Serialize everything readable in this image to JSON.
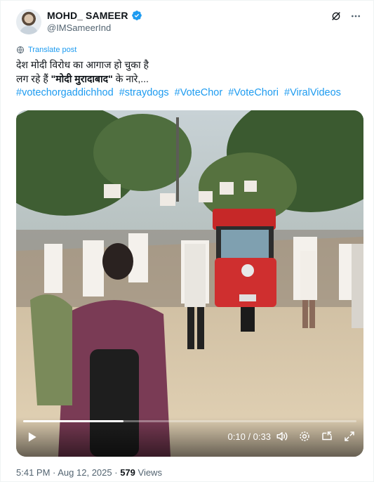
{
  "author": {
    "display_name": "MOHD_ SAMEER",
    "handle": "@IMSameerInd",
    "verified_icon": "verified-badge-icon"
  },
  "header_actions": [
    "grok-icon",
    "more-icon"
  ],
  "translate_label": "Translate post",
  "tweet": {
    "line1": "देश मोदी विरोध का आगाज हो चुका है",
    "line2_prefix": "लग रहे हैं ",
    "line2_bold": "\"मोदी मुरादाबाद\"",
    "line2_suffix": " के नारे,...",
    "hashtags": [
      "#votechorgaddichhod",
      "#straydogs",
      "#VoteChor",
      "#VoteChori",
      "#ViralVideos"
    ]
  },
  "video": {
    "time_display": "0:10 / 0:33",
    "progress": 0.3,
    "controls": [
      "play-icon",
      "volume-icon",
      "settings-icon",
      "pip-icon",
      "fullscreen-icon"
    ]
  },
  "meta": {
    "time": "5:41 PM",
    "separator": " · ",
    "date": "Aug 12, 2025",
    "views_count": "579",
    "views_label": " Views"
  },
  "colors": {
    "link": "#1d9bf0",
    "secondary_text": "#536471",
    "primary_text": "#0f1419"
  }
}
